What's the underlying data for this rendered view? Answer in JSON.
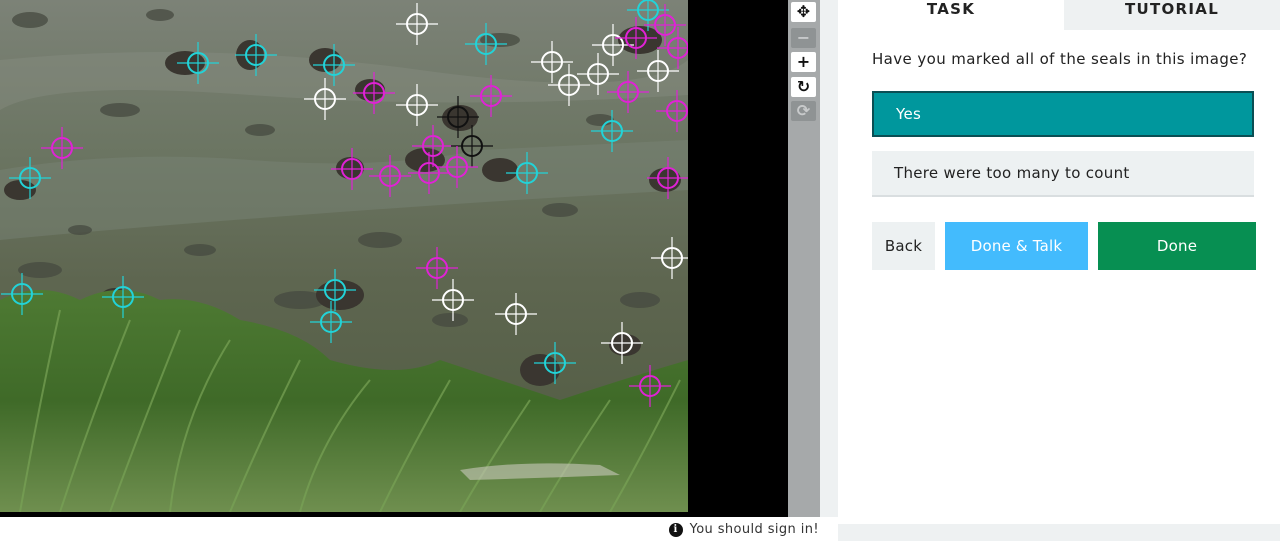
{
  "viewer": {
    "toolbar": [
      {
        "name": "move-icon",
        "glyph": "✥",
        "enabled": true
      },
      {
        "name": "zoom-out-icon",
        "glyph": "−",
        "enabled": false
      },
      {
        "name": "zoom-in-icon",
        "glyph": "+",
        "enabled": true
      },
      {
        "name": "rotate-icon",
        "glyph": "↻",
        "enabled": true
      },
      {
        "name": "reset-icon",
        "glyph": "⟳",
        "enabled": false
      }
    ],
    "marker_colors": {
      "cyan": "#22d3d8",
      "magenta": "#e022d6",
      "white": "#ffffff",
      "black": "#111111"
    }
  },
  "footer": {
    "sign_in_text": "You should sign in!",
    "info_glyph": "i"
  },
  "panel": {
    "tabs": {
      "task": "TASK",
      "tutorial": "TUTORIAL"
    },
    "question": "Have you marked all of the seals in this image?",
    "answers": {
      "yes": "Yes",
      "too_many": "There were too many to count"
    },
    "selected_answer": "Yes",
    "buttons": {
      "back": "Back",
      "done_talk": "Done & Talk",
      "done": "Done"
    }
  }
}
